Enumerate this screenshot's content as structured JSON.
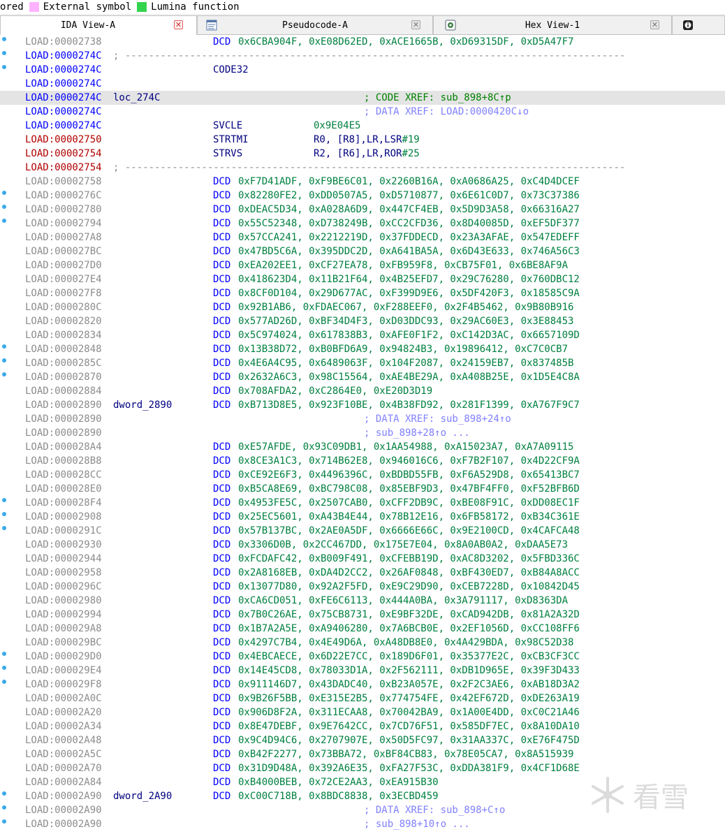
{
  "legend": [
    {
      "label": "ored",
      "color": ""
    },
    {
      "label": "External symbol",
      "color": "#ffb3ff"
    },
    {
      "label": "Lumina function",
      "color": "#33d44d"
    }
  ],
  "tabs": [
    {
      "label": "IDA View-A",
      "active": true,
      "close": "red"
    },
    {
      "label": "Pseudocode-A",
      "active": false,
      "close": "gray"
    },
    {
      "label": "Hex View-1",
      "active": false,
      "close": "gray"
    }
  ],
  "watermark": {
    "text": "看雪"
  },
  "lines": [
    {
      "addr": "LOAD:00002738",
      "kind": "dcd",
      "dot": true,
      "values": "0x6CBA904F, 0xE08D62ED, 0xACE1665B, 0xD69315DF, 0xD5A47F7"
    },
    {
      "addr": "LOAD:0000274C",
      "kind": "sep",
      "dot": true,
      "addrStyle": "code"
    },
    {
      "addr": "LOAD:0000274C",
      "kind": "mnem",
      "dot": true,
      "addrStyle": "code",
      "mnem": "CODE32",
      "ops": ""
    },
    {
      "addr": "LOAD:0000274C",
      "kind": "blank",
      "addrStyle": "code"
    },
    {
      "addr": "LOAD:0000274C",
      "kind": "label",
      "addrStyle": "code",
      "label": "loc_274C",
      "comment": "; CODE XREF: sub_898+8C↑p",
      "commentStyle": "code",
      "highlight": true
    },
    {
      "addr": "LOAD:0000274C",
      "kind": "comment",
      "addrStyle": "code",
      "comment": "; DATA XREF: LOAD:0000420C↓o",
      "commentStyle": "data"
    },
    {
      "addr": "LOAD:0000274C",
      "kind": "mnem",
      "addrStyle": "code",
      "mnem": "SVCLE",
      "ops": "0x9E04E5"
    },
    {
      "addr": "LOAD:00002750",
      "kind": "mnem",
      "addrStyle": "red",
      "mnem": "STRTMI",
      "ops": "R0, [R8],LR,LSR#19"
    },
    {
      "addr": "LOAD:00002754",
      "kind": "mnem",
      "addrStyle": "red",
      "mnem": "STRVS",
      "ops": "R2, [R6],LR,ROR#25"
    },
    {
      "addr": "LOAD:00002754",
      "kind": "sep",
      "addrStyle": "red"
    },
    {
      "addr": "LOAD:00002758",
      "kind": "dcd",
      "values": "0xF7D41ADF, 0xF9BE6C01, 0x2260B16A, 0xA0686A25, 0xC4D4DCEF"
    },
    {
      "addr": "LOAD:0000276C",
      "kind": "dcd",
      "dot": true,
      "values": "0x82280FE2, 0xDD0507A5, 0xD5710877, 0x6E61C0D7, 0x73C37386"
    },
    {
      "addr": "LOAD:00002780",
      "kind": "dcd",
      "dot": true,
      "values": "0xDEAC5D34, 0xA028A6D9, 0x447CF4EB, 0x5D9D3A58, 0x66316A27"
    },
    {
      "addr": "LOAD:00002794",
      "kind": "dcd",
      "dot": true,
      "values": "0x55C52348, 0xD738249B, 0xCC2CFD36, 0x8D40085D, 0xEF5DF377"
    },
    {
      "addr": "LOAD:000027A8",
      "kind": "dcd",
      "values": "0x57CCA241, 0x2212219D, 0x37FDDECD, 0x23A3AFAE, 0x547EDEFF"
    },
    {
      "addr": "LOAD:000027BC",
      "kind": "dcd",
      "values": "0x47BD5C6A, 0x395DDC2D, 0xA641BA5A, 0x6D43E633, 0x746A56C3"
    },
    {
      "addr": "LOAD:000027D0",
      "kind": "dcd",
      "values": "0xEA202EE1, 0xCF27EA78, 0xFB959F8, 0xCB75F01, 0x6BE8AF9A"
    },
    {
      "addr": "LOAD:000027E4",
      "kind": "dcd",
      "values": "0x418623D4, 0x11B21F64, 0x4B25EFD7, 0x29C76280, 0x760DBC12"
    },
    {
      "addr": "LOAD:000027F8",
      "kind": "dcd",
      "values": "0x8CF0D104, 0x29D677AC, 0xF399D9E6, 0x5DF420F3, 0x18585C9A"
    },
    {
      "addr": "LOAD:0000280C",
      "kind": "dcd",
      "values": "0x92B1AB6, 0xFDAEC067, 0xF288EEF0, 0x2F4B5462, 0x9B80B916"
    },
    {
      "addr": "LOAD:00002820",
      "kind": "dcd",
      "values": "0x577AD26D, 0xBF34D4F3, 0xD03DDC93, 0x29AC60E3, 0x3E88453"
    },
    {
      "addr": "LOAD:00002834",
      "kind": "dcd",
      "values": "0x5C974024, 0x617838B3, 0xAFE0F1F2, 0xC142D3AC, 0x6657109D"
    },
    {
      "addr": "LOAD:00002848",
      "kind": "dcd",
      "dot": true,
      "values": "0x13B38D72, 0xB0BFD6A9, 0x94824B3, 0x19896412, 0xC7C0CB7"
    },
    {
      "addr": "LOAD:0000285C",
      "kind": "dcd",
      "dot": true,
      "values": "0x4E6A4C95, 0x6489063F, 0x104F2087, 0x24159EB7, 0x837485B"
    },
    {
      "addr": "LOAD:00002870",
      "kind": "dcd",
      "dot": true,
      "values": "0x2632A6C3, 0x98C15564, 0xAE4BE29A, 0xA408B25E, 0x1D5E4C8A"
    },
    {
      "addr": "LOAD:00002884",
      "kind": "dcd",
      "values": "0x708AFDA2, 0xC2864E0, 0xE20D3D19"
    },
    {
      "addr": "LOAD:00002890",
      "kind": "dcd",
      "label": "dword_2890",
      "values": "0xB713D8E5, 0x923F10BE, 0x4B38FD92, 0x281F1399, 0xA767F9C7"
    },
    {
      "addr": "LOAD:00002890",
      "kind": "comment",
      "comment": "; DATA XREF: sub_898+24↑o",
      "commentStyle": "data"
    },
    {
      "addr": "LOAD:00002890",
      "kind": "comment",
      "comment": "; sub_898+28↑o ...",
      "commentStyle": "data"
    },
    {
      "addr": "LOAD:000028A4",
      "kind": "dcd",
      "values": "0xE57AFDE, 0x93C09DB1, 0x1AA54988, 0xA15023A7, 0xA7A09115"
    },
    {
      "addr": "LOAD:000028B8",
      "kind": "dcd",
      "values": "0x8CE3A1C3, 0x714B62E8, 0x946016C6, 0xF7B2F107, 0x4D22CF9A"
    },
    {
      "addr": "LOAD:000028CC",
      "kind": "dcd",
      "values": "0xCE92E6F3, 0x4496396C, 0xBDBD55FB, 0xF6A529D8, 0x65413BC7"
    },
    {
      "addr": "LOAD:000028E0",
      "kind": "dcd",
      "values": "0xB5CA8E69, 0xBC798C08, 0x85EBF9D3, 0x47BF4FF0, 0xF52BFB6D"
    },
    {
      "addr": "LOAD:000028F4",
      "kind": "dcd",
      "dot": true,
      "values": "0x4953FE5C, 0x2507CAB0, 0xCFF2DB9C, 0xBE08F91C, 0xDD08EC1F"
    },
    {
      "addr": "LOAD:00002908",
      "kind": "dcd",
      "dot": true,
      "values": "0x25EC5601, 0xA43B4E44, 0x78B12E16, 0x6FB58172, 0xB34C361E"
    },
    {
      "addr": "LOAD:0000291C",
      "kind": "dcd",
      "dot": true,
      "values": "0x57B137BC, 0x2AE0A5DF, 0x6666E66C, 0x9E2100CD, 0x4CAFCA48"
    },
    {
      "addr": "LOAD:00002930",
      "kind": "dcd",
      "values": "0x3306D0B, 0x2CC467DD, 0x175E7E04, 0x8A0AB0A2, 0xDAA5E73"
    },
    {
      "addr": "LOAD:00002944",
      "kind": "dcd",
      "values": "0xFCDAFC42, 0xB009F491, 0xCFEBB19D, 0xAC8D3202, 0x5FBD336C"
    },
    {
      "addr": "LOAD:00002958",
      "kind": "dcd",
      "values": "0x2A8168EB, 0xDA4D2CC2, 0x26AF0848, 0xBF430ED7, 0xB84A8ACC"
    },
    {
      "addr": "LOAD:0000296C",
      "kind": "dcd",
      "values": "0x13077D80, 0x92A2F5FD, 0xE9C29D90, 0xCEB7228D, 0x10842D45"
    },
    {
      "addr": "LOAD:00002980",
      "kind": "dcd",
      "values": "0xCA6CD051, 0xFE6C6113, 0x444A0BA, 0x3A791117, 0xD8363DA"
    },
    {
      "addr": "LOAD:00002994",
      "kind": "dcd",
      "values": "0x7B0C26AE, 0x75CB8731, 0xE9BF32DE, 0xCAD942DB, 0x81A2A32D"
    },
    {
      "addr": "LOAD:000029A8",
      "kind": "dcd",
      "values": "0x1B7A2A5E, 0xA9406280, 0x7A6BCB0E, 0x2EF1056D, 0xCC108FF6"
    },
    {
      "addr": "LOAD:000029BC",
      "kind": "dcd",
      "values": "0x4297C7B4, 0x4E49D6A, 0xA48DB8E0, 0x4A429BDA, 0x98C52D38"
    },
    {
      "addr": "LOAD:000029D0",
      "kind": "dcd",
      "dot": true,
      "values": "0x4EBCAECE, 0x6D22E7CC, 0x189D6F01, 0x35377E2C, 0xCB3CF3CC"
    },
    {
      "addr": "LOAD:000029E4",
      "kind": "dcd",
      "dot": true,
      "values": "0x14E45CD8, 0x78033D1A, 0x2F562111, 0xDB1D965E, 0x39F3D433"
    },
    {
      "addr": "LOAD:000029F8",
      "kind": "dcd",
      "dot": true,
      "values": "0x911146D7, 0x43DADC40, 0xB23A057E, 0x2F2C3AE6, 0xAB18D3A2"
    },
    {
      "addr": "LOAD:00002A0C",
      "kind": "dcd",
      "values": "0x9B26F5BB, 0xE315E2B5, 0x774754FE, 0x42EF672D, 0xDE263A19"
    },
    {
      "addr": "LOAD:00002A20",
      "kind": "dcd",
      "values": "0x906D8F2A, 0x311ECAA8, 0x70042BA9, 0x1A00E4DD, 0xC0C21A46"
    },
    {
      "addr": "LOAD:00002A34",
      "kind": "dcd",
      "values": "0x8E47DEBF, 0x9E7642CC, 0x7CD76F51, 0x585DF7EC, 0x8A10DA10"
    },
    {
      "addr": "LOAD:00002A48",
      "kind": "dcd",
      "values": "0x9C4D94C6, 0x2707907E, 0x50D5FC97, 0x31AA337C, 0xE76F475D"
    },
    {
      "addr": "LOAD:00002A5C",
      "kind": "dcd",
      "values": "0xB42F2277, 0x73BBA72, 0xBF84CB83, 0x78E05CA7, 0x8A515939"
    },
    {
      "addr": "LOAD:00002A70",
      "kind": "dcd",
      "values": "0x31D9D48A, 0x392A6E35, 0xFA27F53C, 0xDDA381F9, 0x4CF1D68E"
    },
    {
      "addr": "LOAD:00002A84",
      "kind": "dcd",
      "values": "0xB4000BEB, 0x72CE2AA3, 0xEA915B30"
    },
    {
      "addr": "LOAD:00002A90",
      "kind": "dcd",
      "dot": true,
      "label": "dword_2A90",
      "values": "0xC00C718B, 0x8BDC8838, 0x3ECBD459"
    },
    {
      "addr": "LOAD:00002A90",
      "kind": "comment",
      "dot": true,
      "comment": "; DATA XREF: sub_898+C↑o",
      "commentStyle": "data"
    },
    {
      "addr": "LOAD:00002A90",
      "kind": "comment",
      "dot": true,
      "comment": "; sub_898+10↑o ...",
      "commentStyle": "data"
    }
  ]
}
